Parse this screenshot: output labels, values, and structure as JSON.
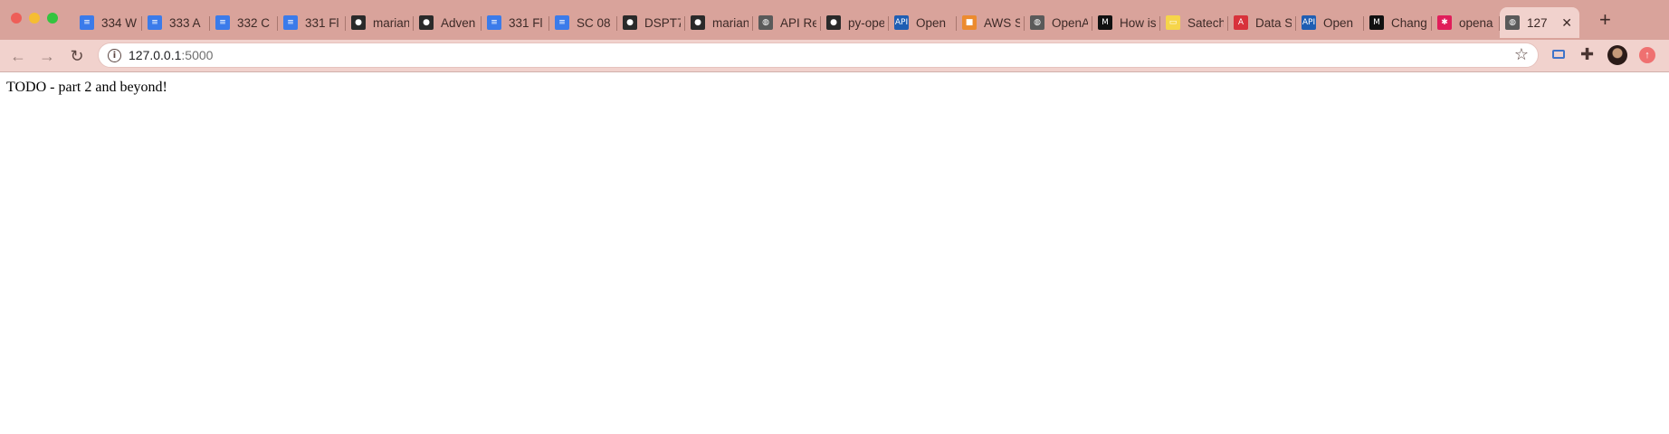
{
  "window": {
    "tabs": [
      {
        "label": "334 W",
        "icon": "doc-icon"
      },
      {
        "label": "333 A",
        "icon": "doc-icon"
      },
      {
        "label": "332 C",
        "icon": "doc-icon"
      },
      {
        "label": "331 Fl",
        "icon": "doc-icon"
      },
      {
        "label": "marian",
        "icon": "github-icon"
      },
      {
        "label": "Adven",
        "icon": "github-icon"
      },
      {
        "label": "331 Fl",
        "icon": "doc-icon"
      },
      {
        "label": "SC 08",
        "icon": "doc-icon"
      },
      {
        "label": "DSPT7",
        "icon": "github-icon"
      },
      {
        "label": "marian",
        "icon": "github-icon"
      },
      {
        "label": "API Re",
        "icon": "globe-icon"
      },
      {
        "label": "py-ope",
        "icon": "github-icon"
      },
      {
        "label": "Open",
        "icon": "api-icon"
      },
      {
        "label": "AWS S",
        "icon": "aws-icon"
      },
      {
        "label": "OpenA",
        "icon": "globe-icon"
      },
      {
        "label": "How is",
        "icon": "medium-icon"
      },
      {
        "label": "Satech",
        "icon": "tag-icon"
      },
      {
        "label": "Data S",
        "icon": "angular-icon"
      },
      {
        "label": "Open",
        "icon": "api-icon"
      },
      {
        "label": "Chang",
        "icon": "medium-icon"
      },
      {
        "label": "opena",
        "icon": "slack-icon"
      },
      {
        "label": "127",
        "icon": "globe-icon",
        "active": true
      }
    ],
    "new_tab": "+"
  },
  "toolbar": {
    "url_host": "127.0.0.1",
    "url_port": ":5000"
  },
  "page": {
    "body_text": "TODO - part 2 and beyond!"
  },
  "colors": {
    "tabstrip": "#d9a39b",
    "toolbar": "#f1d2cd"
  }
}
